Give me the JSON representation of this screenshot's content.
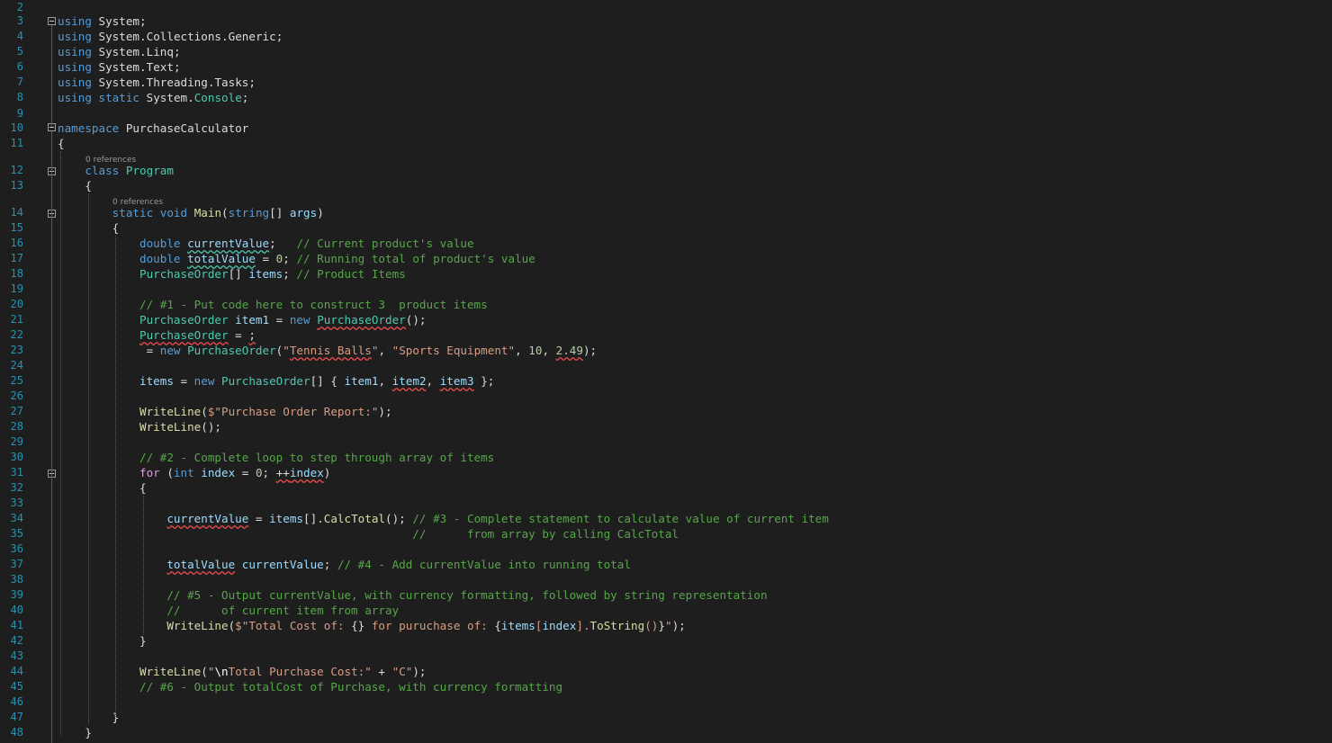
{
  "editor": {
    "language": "C#",
    "colors": {
      "background": "#1e1e1e",
      "line_number": "#2b91af",
      "keyword": "#569cd6",
      "control_keyword": "#d8a0df",
      "type": "#4ec9b0",
      "identifier": "#9cdcfe",
      "method": "#dcdcaa",
      "string": "#d69d85",
      "number": "#b5cea8",
      "comment": "#57a64a",
      "error_squiggle": "#f14c4c"
    },
    "code_lens": {
      "class_refs": "0 references",
      "method_refs": "0 references"
    },
    "lines": [
      {
        "n": "2",
        "code": ""
      },
      {
        "n": "3",
        "code": "using System;"
      },
      {
        "n": "4",
        "code": "using System.Collections.Generic;"
      },
      {
        "n": "5",
        "code": "using System.Linq;"
      },
      {
        "n": "6",
        "code": "using System.Text;"
      },
      {
        "n": "7",
        "code": "using System.Threading.Tasks;"
      },
      {
        "n": "8",
        "code": "using static System.Console;"
      },
      {
        "n": "9",
        "code": ""
      },
      {
        "n": "10",
        "code": "namespace PurchaseCalculator"
      },
      {
        "n": "11",
        "code": "{"
      },
      {
        "n": "12",
        "code": "    class Program"
      },
      {
        "n": "13",
        "code": "    {"
      },
      {
        "n": "14",
        "code": "        static void Main(string[] args)"
      },
      {
        "n": "15",
        "code": "        {"
      },
      {
        "n": "16",
        "code": "            double currentValue;   // Current product's value"
      },
      {
        "n": "17",
        "code": "            double totalValue = 0; // Running total of product's value"
      },
      {
        "n": "18",
        "code": "            PurchaseOrder[] items; // Product Items"
      },
      {
        "n": "19",
        "code": ""
      },
      {
        "n": "20",
        "code": "            // #1 - Put code here to construct 3  product items"
      },
      {
        "n": "21",
        "code": "            PurchaseOrder item1 = new PurchaseOrder();"
      },
      {
        "n": "22",
        "code": "            PurchaseOrder = ;"
      },
      {
        "n": "23",
        "code": "             = new PurchaseOrder(\"Tennis Balls\", \"Sports Equipment\", 10, 2.49);"
      },
      {
        "n": "24",
        "code": ""
      },
      {
        "n": "25",
        "code": "            items = new PurchaseOrder[] { item1, item2, item3 };"
      },
      {
        "n": "26",
        "code": ""
      },
      {
        "n": "27",
        "code": "            WriteLine($\"Purchase Order Report:\");"
      },
      {
        "n": "28",
        "code": "            WriteLine();"
      },
      {
        "n": "29",
        "code": ""
      },
      {
        "n": "30",
        "code": "            // #2 - Complete loop to step through array of items"
      },
      {
        "n": "31",
        "code": "            for (int index = 0; ++index)"
      },
      {
        "n": "32",
        "code": "            {"
      },
      {
        "n": "33",
        "code": ""
      },
      {
        "n": "34",
        "code": "                currentValue = items[].CalcTotal(); // #3 - Complete statement to calculate value of current item"
      },
      {
        "n": "35",
        "code": "                                                    //      from array by calling CalcTotal"
      },
      {
        "n": "36",
        "code": ""
      },
      {
        "n": "37",
        "code": "                totalValue currentValue; // #4 - Add currentValue into running total"
      },
      {
        "n": "38",
        "code": ""
      },
      {
        "n": "39",
        "code": "                // #5 - Output currentValue, with currency formatting, followed by string representation"
      },
      {
        "n": "40",
        "code": "                //      of current item from array"
      },
      {
        "n": "41",
        "code": "                WriteLine($\"Total Cost of: {} for puruchase of: {items[index].ToString()}\");"
      },
      {
        "n": "42",
        "code": "            }"
      },
      {
        "n": "43",
        "code": ""
      },
      {
        "n": "44",
        "code": "            WriteLine(\"\\nTotal Purchase Cost:\" + \"C\");"
      },
      {
        "n": "45",
        "code": "            // #6 - Output totalCost of Purchase, with currency formatting"
      },
      {
        "n": "46",
        "code": ""
      },
      {
        "n": "47",
        "code": "        }"
      },
      {
        "n": "48",
        "code": "    }"
      }
    ]
  }
}
